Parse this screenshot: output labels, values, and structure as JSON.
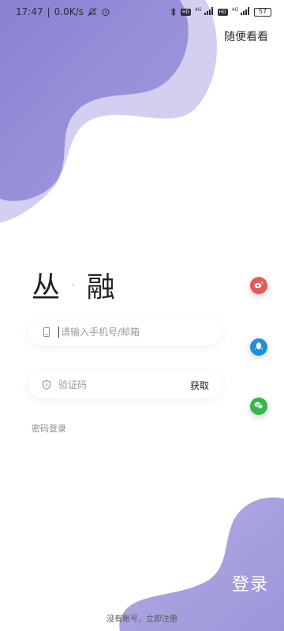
{
  "status_bar": {
    "time": "17:47",
    "net_speed": "0.0K/s",
    "network_label_1": "4G",
    "network_label_2": "4G",
    "battery": "57"
  },
  "top_link": "随便看看",
  "brand": {
    "part1": "丛",
    "dot": "·",
    "part2": "融"
  },
  "phone_field": {
    "placeholder": "请输入手机号/邮箱",
    "value": ""
  },
  "code_field": {
    "placeholder": "验证码",
    "value": "",
    "get_code_label": "获取"
  },
  "password_login": "密码登录",
  "social_icons": [
    "weibo-icon",
    "qq-icon",
    "wechat-icon"
  ],
  "login_button": "登录",
  "register_link": "没有账号，立即注册",
  "colors": {
    "blob_dark": "#8d84d4",
    "blob_light": "#cfcaee",
    "weibo": "#e45a5a",
    "qq": "#1f8fd8",
    "wechat": "#33b74a"
  }
}
